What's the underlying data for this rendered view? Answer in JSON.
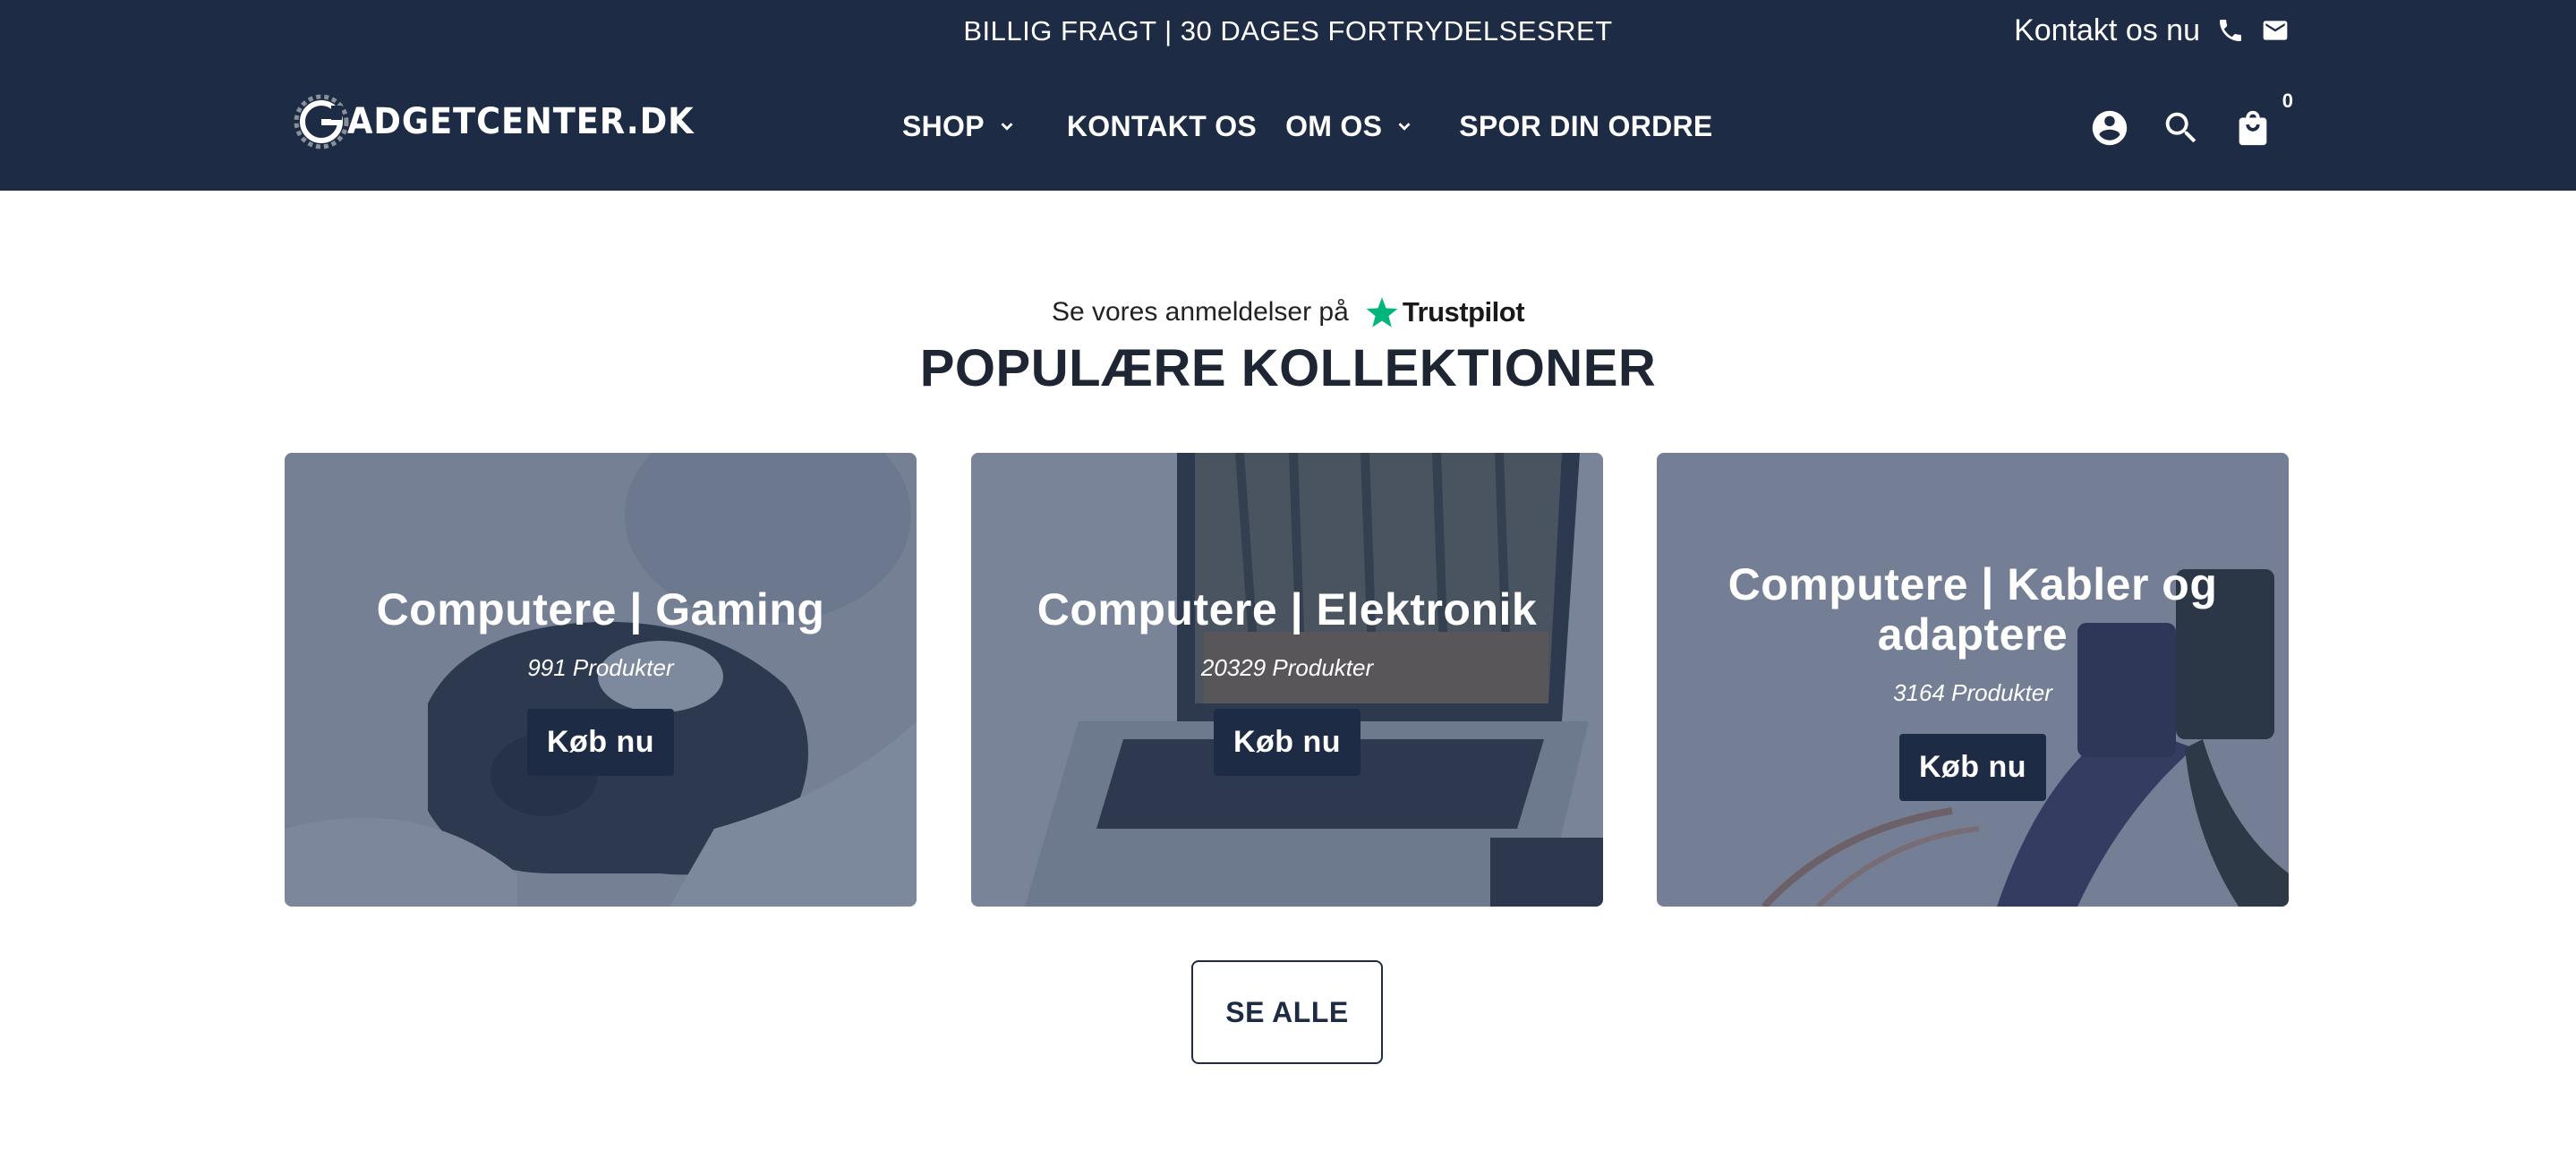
{
  "topbar": {
    "message": "BILLIG FRAGT | 30 DAGES FORTRYDELSESRET",
    "contact_label": "Kontakt os nu",
    "icons": [
      "phone-icon",
      "mail-icon"
    ]
  },
  "logo": {
    "text": "ADGETCENTER.DK"
  },
  "nav": {
    "items": [
      {
        "label": "SHOP",
        "has_dropdown": true
      },
      {
        "label": "KONTAKT OS",
        "has_dropdown": false
      },
      {
        "label": "OM OS",
        "has_dropdown": true
      },
      {
        "label": "SPOR DIN ORDRE",
        "has_dropdown": false
      }
    ]
  },
  "actions": {
    "icons": [
      "account-icon",
      "search-icon",
      "cart-icon"
    ],
    "cart_count": "0"
  },
  "trustpilot": {
    "text": "Se vores anmeldelser på",
    "brand": "Trustpilot",
    "star_color": "#00b67a"
  },
  "section": {
    "title": "POPULÆRE KOLLEKTIONER"
  },
  "collections": [
    {
      "title": "Computere | Gaming",
      "count": "991 Produkter",
      "button": "Køb nu"
    },
    {
      "title": "Computere | Elektronik",
      "count": "20329 Produkter",
      "button": "Køb nu"
    },
    {
      "title": "Computere | Kabler og adaptere",
      "count": "3164 Produkter",
      "button": "Køb nu"
    }
  ],
  "see_all": {
    "label": "SE ALLE"
  },
  "colors": {
    "header_bg": "#1d2b45",
    "button_bg": "#1d2b45",
    "title_text": "#1e2533"
  }
}
